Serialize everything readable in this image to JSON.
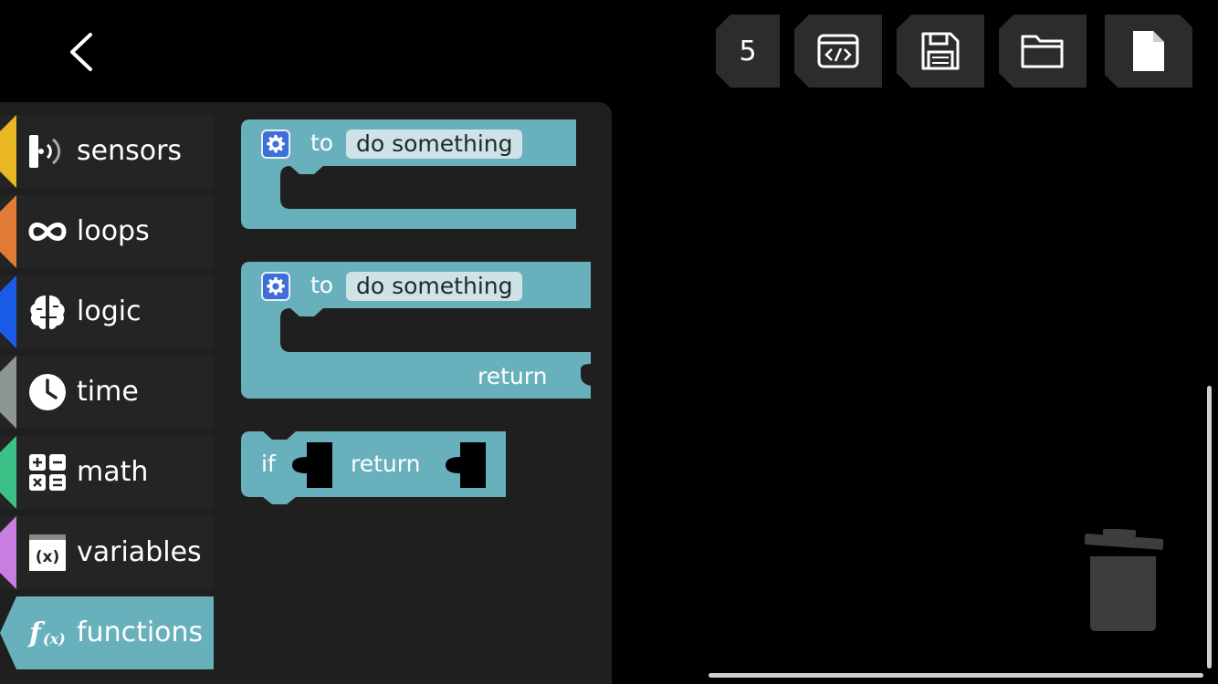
{
  "toolbar": {
    "block_count": "5"
  },
  "categories": [
    {
      "label": "sensors",
      "color": "#e9b723",
      "icon": "sensors-icon"
    },
    {
      "label": "loops",
      "color": "#e07a35",
      "icon": "loop-infinity-icon"
    },
    {
      "label": "logic",
      "color": "#1a5ce8",
      "icon": "brain-icon"
    },
    {
      "label": "time",
      "color": "#8e9595",
      "icon": "clock-icon"
    },
    {
      "label": "math",
      "color": "#3dc088",
      "icon": "calculator-icon"
    },
    {
      "label": "variables",
      "color": "#c77ee0",
      "icon": "variable-x-icon"
    },
    {
      "label": "functions",
      "color": "#69b0bd",
      "icon": "function-fx-icon",
      "active": true
    }
  ],
  "blocks": {
    "proc_noreturn": {
      "keyword": "to",
      "name": "do something"
    },
    "proc_return": {
      "keyword": "to",
      "name": "do something",
      "return_label": "return"
    },
    "if_return": {
      "if_label": "if",
      "return_label": "return"
    }
  },
  "colors": {
    "function_block": "#69b0bd",
    "background": "#000000",
    "flyout": "#1f1f1f",
    "toolbar": "#2c2c2c"
  }
}
